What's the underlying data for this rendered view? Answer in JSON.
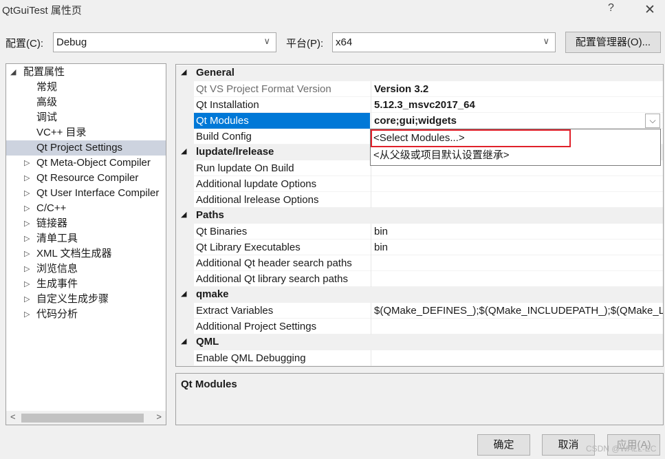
{
  "window": {
    "title": "QtGuiTest 属性页",
    "help": "?",
    "close": "✕"
  },
  "config": {
    "config_label": "配置(C):",
    "config_value": "Debug",
    "platform_label": "平台(P):",
    "platform_value": "x64",
    "manager_button": "配置管理器(O)..."
  },
  "tree": {
    "items": [
      {
        "label": "配置属性",
        "expander": "◢"
      },
      {
        "label": "常规",
        "expander": ""
      },
      {
        "label": "高级",
        "expander": ""
      },
      {
        "label": "调试",
        "expander": ""
      },
      {
        "label": "VC++ 目录",
        "expander": ""
      },
      {
        "label": "Qt Project Settings",
        "expander": "",
        "selected": true
      },
      {
        "label": "Qt Meta-Object Compiler",
        "expander": "▷"
      },
      {
        "label": "Qt Resource Compiler",
        "expander": "▷"
      },
      {
        "label": "Qt User Interface Compiler",
        "expander": "▷"
      },
      {
        "label": "C/C++",
        "expander": "▷"
      },
      {
        "label": "链接器",
        "expander": "▷"
      },
      {
        "label": "清单工具",
        "expander": "▷"
      },
      {
        "label": "XML 文档生成器",
        "expander": "▷"
      },
      {
        "label": "浏览信息",
        "expander": "▷"
      },
      {
        "label": "生成事件",
        "expander": "▷"
      },
      {
        "label": "自定义生成步骤",
        "expander": "▷"
      },
      {
        "label": "代码分析",
        "expander": "▷"
      }
    ],
    "scroll_left": "<",
    "scroll_right": ">"
  },
  "grid": {
    "collapse_glyph": "◢",
    "rows": [
      {
        "type": "cat",
        "label": "General"
      },
      {
        "type": "prop",
        "name": "Qt VS Project Format Version",
        "value": "Version 3.2",
        "bold": true,
        "readonly": true
      },
      {
        "type": "prop",
        "name": "Qt Installation",
        "value": "5.12.3_msvc2017_64",
        "bold": true
      },
      {
        "type": "prop",
        "name": "Qt Modules",
        "value": "core;gui;widgets",
        "bold": true,
        "selected": true
      },
      {
        "type": "prop",
        "name": "Build Config",
        "value": ""
      },
      {
        "type": "cat",
        "label": "lupdate/lrelease"
      },
      {
        "type": "prop",
        "name": "Run lupdate On Build",
        "value": ""
      },
      {
        "type": "prop",
        "name": "Additional lupdate Options",
        "value": ""
      },
      {
        "type": "prop",
        "name": "Additional lrelease Options",
        "value": ""
      },
      {
        "type": "cat",
        "label": "Paths"
      },
      {
        "type": "prop",
        "name": "Qt Binaries",
        "value": "bin"
      },
      {
        "type": "prop",
        "name": "Qt Library Executables",
        "value": "bin"
      },
      {
        "type": "prop",
        "name": "Additional Qt header search paths",
        "value": ""
      },
      {
        "type": "prop",
        "name": "Additional Qt library search paths",
        "value": ""
      },
      {
        "type": "cat",
        "label": "qmake"
      },
      {
        "type": "prop",
        "name": "Extract Variables",
        "value": "$(QMake_DEFINES_);$(QMake_INCLUDEPATH_);$(QMake_LIBS_)"
      },
      {
        "type": "prop",
        "name": "Additional Project Settings",
        "value": ""
      },
      {
        "type": "cat",
        "label": "QML"
      },
      {
        "type": "prop",
        "name": "Enable QML Debugging",
        "value": ""
      }
    ],
    "dropdown_arrow": "⌵",
    "dropdown_options": [
      "<Select Modules...>",
      "<从父级或项目默认设置继承>"
    ]
  },
  "description": {
    "title": "Qt Modules"
  },
  "buttons": {
    "ok": "确定",
    "cancel": "取消",
    "apply": "应用(A)"
  },
  "watermark": "CSDN @WALL-EC"
}
